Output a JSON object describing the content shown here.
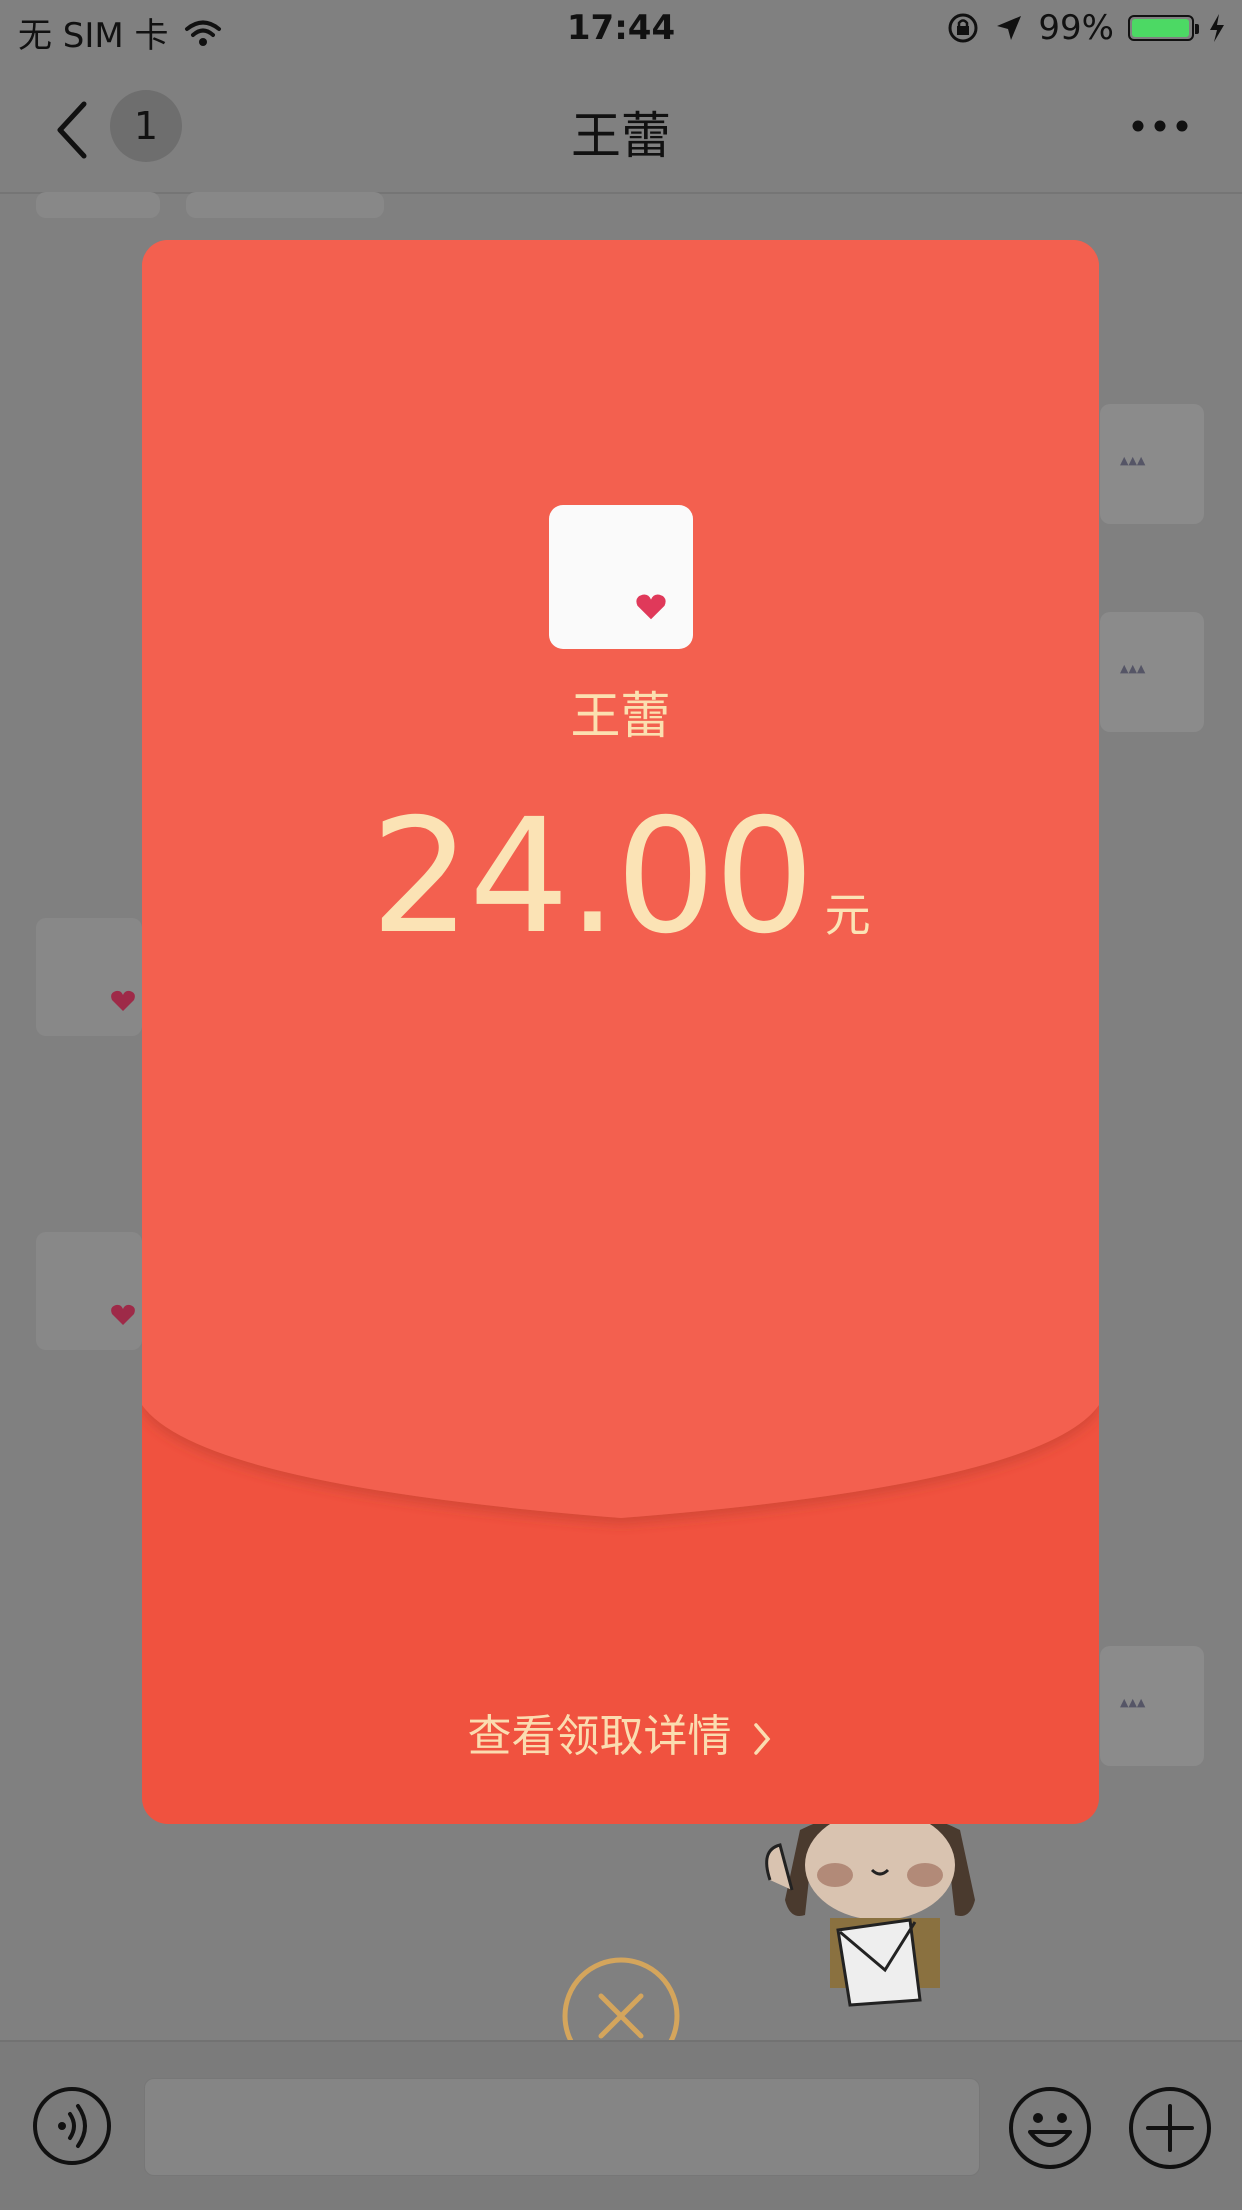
{
  "status_bar": {
    "carrier": "无 SIM 卡",
    "time": "17:44",
    "battery_percent": "99%",
    "battery_level": 0.99,
    "battery_color": "#4cd964"
  },
  "nav": {
    "unread_badge": "1",
    "title": "王蕾"
  },
  "red_packet": {
    "sender_name": "王蕾",
    "amount": "24.00",
    "unit": "元",
    "details_link": "查看领取详情",
    "color_top": "#f36150",
    "color_bottom": "#f0523f",
    "text_color": "#fbe3b5"
  },
  "icons": {
    "back": "chevron-left-icon",
    "more": "more-dots-icon",
    "wifi": "wifi-icon",
    "lock_rotation": "rotation-lock-icon",
    "location": "location-arrow-icon",
    "charging": "charging-bolt-icon",
    "close": "close-circle-icon",
    "voice": "voice-icon",
    "emoji": "emoji-icon",
    "plus": "plus-circle-icon"
  }
}
